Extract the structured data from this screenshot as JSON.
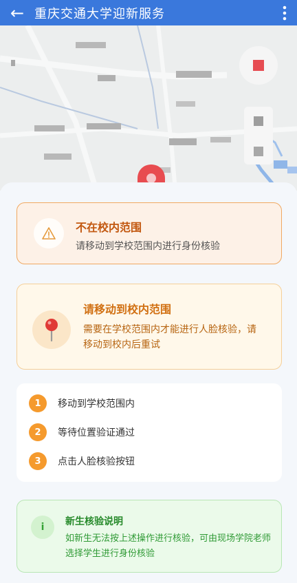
{
  "appbar": {
    "title": "重庆交通大学迎新服务",
    "back_icon": "arrow-left-icon",
    "more_icon": "more-vertical-icon",
    "color": "#3a78dc"
  },
  "map": {
    "marker_icon": "location-marker-icon"
  },
  "alert": {
    "title": "不在校内范围",
    "message": "请移动到学校范围内进行身份核验",
    "icon": "warning-triangle-icon",
    "color": "#c2570f"
  },
  "move_card": {
    "title": "请移动到校内范围",
    "message": "需要在学校范围内才能进行人脸核验，请移动到校内后重试",
    "icon": "pushpin-icon",
    "color": "#d17012"
  },
  "steps": [
    {
      "number": "1",
      "label": "移动到学校范围内"
    },
    {
      "number": "2",
      "label": "等待位置验证通过"
    },
    {
      "number": "3",
      "label": "点击人脸核验按钮"
    }
  ],
  "note": {
    "title": "新生核验说明",
    "message": "如新生无法按上述操作进行核验，可由现场学院老师选择学生进行身份核验",
    "icon_text": "i",
    "color": "#278a2b"
  }
}
